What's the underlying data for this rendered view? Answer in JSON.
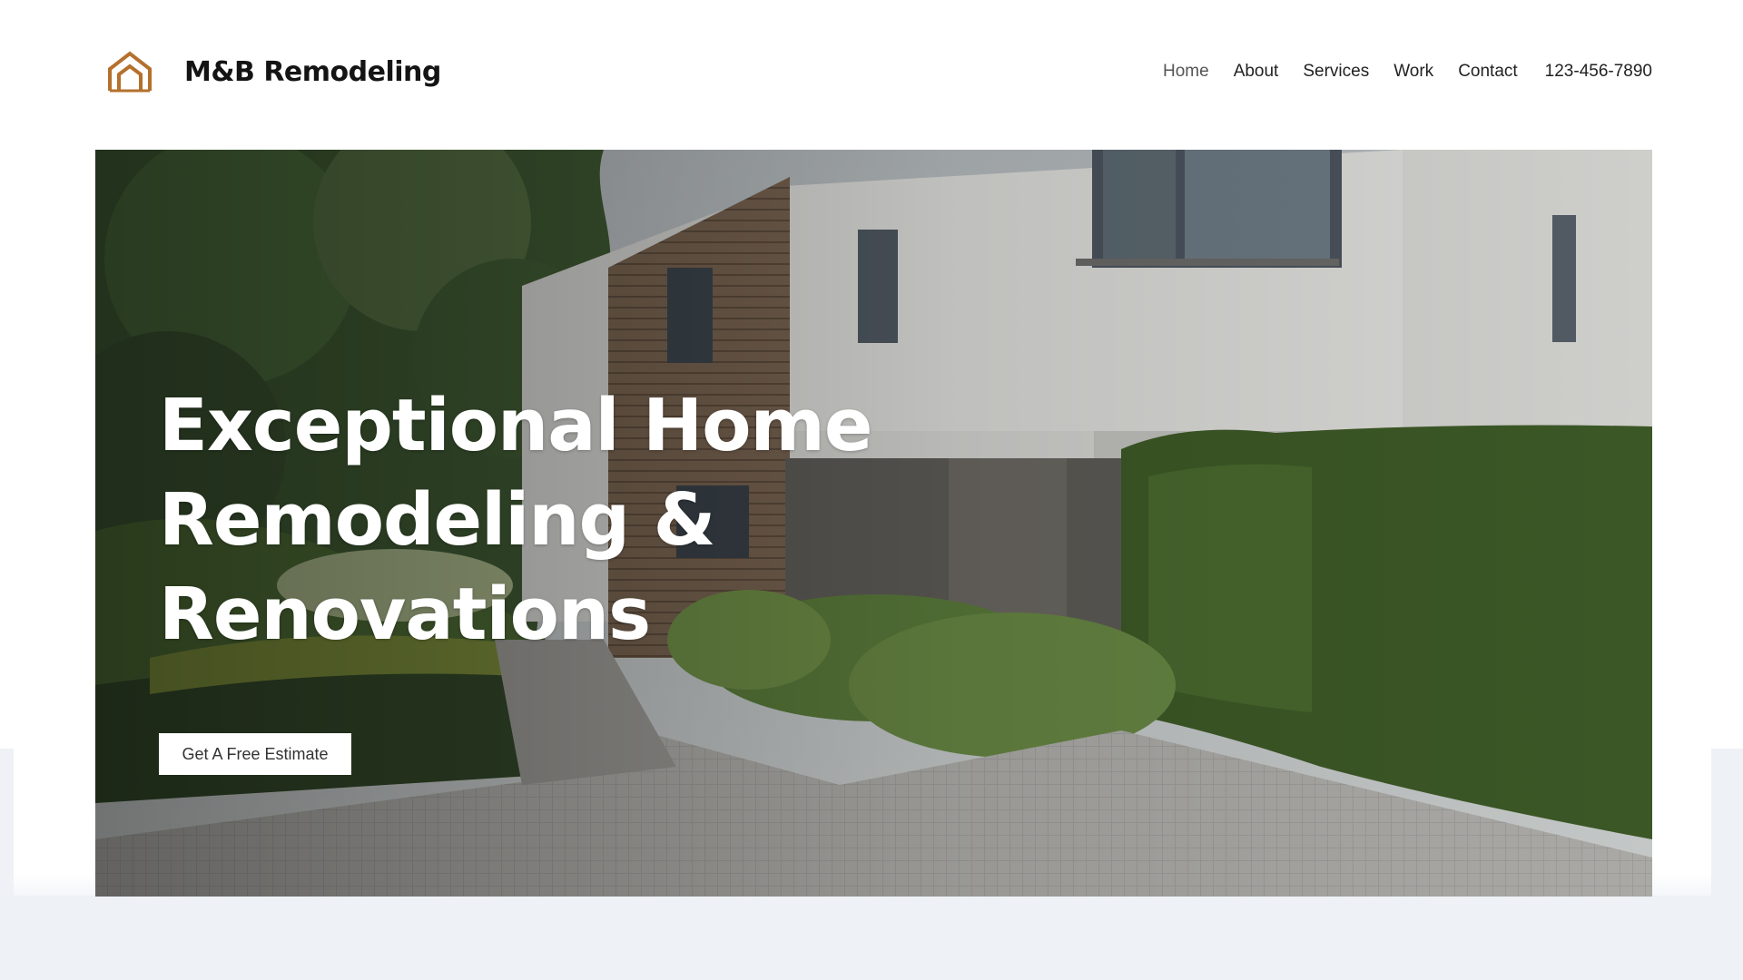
{
  "brand": {
    "name": "M&B Remodeling",
    "logo_icon": "house-outline-icon",
    "accent": "#b5702c"
  },
  "nav": {
    "items": [
      "Home",
      "About",
      "Services",
      "Work",
      "Contact"
    ],
    "active": "Home",
    "phone": "123-456-7890"
  },
  "hero": {
    "title_lines": [
      "Exceptional Home",
      "Remodeling &",
      "Renovations"
    ],
    "cta_label": "Get A Free Estimate",
    "image": "modern-house-with-garden-photo"
  }
}
